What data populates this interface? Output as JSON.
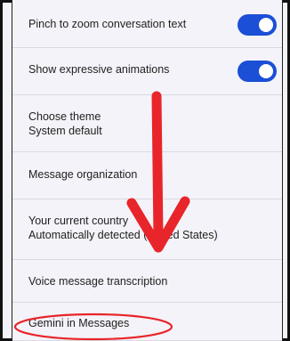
{
  "settings": {
    "items": [
      {
        "title": "Pinch to zoom conversation text",
        "toggle": true
      },
      {
        "title": "Show expressive animations",
        "toggle": true
      },
      {
        "title": "Choose theme",
        "subtitle": "System default"
      },
      {
        "title": "Message organization"
      },
      {
        "title": "Your current country",
        "subtitle": "Automatically detected (United States)"
      },
      {
        "title": "Voice message transcription"
      },
      {
        "title": "Gemini in Messages"
      }
    ]
  },
  "annotations": {
    "arrow_color": "#e8252a",
    "circle_color": "#e8252a",
    "toggle_color": "#1a4fd6"
  }
}
